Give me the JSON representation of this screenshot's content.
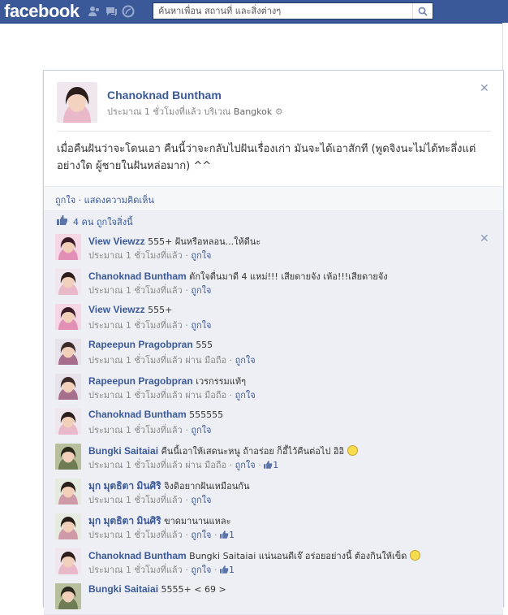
{
  "topbar": {
    "logo": "facebook",
    "search_placeholder": "ค้นหาเพื่อน สถานที่ และสิ่งต่างๆ"
  },
  "post": {
    "author": "Chanoknad Buntham",
    "time": "ประมาณ 1 ชั่วโมงที่แล้ว",
    "location_prefix": "บริเวณ",
    "location": "Bangkok",
    "text": "เมื่อคืนฝันว่าจะโดนเอา คืนนี้ว่าจะกลับไปฝันเรื่องเก่า มันจะได้เอาสักที (พูดจิงนะไม่ได้ทะลึ่งแต่อย่างใด ผู้ชายในฝันหล่อมาก) ^^",
    "actions": "ถูกใจ · แสดงความคิดเห็น",
    "likes": "4 คน ถูกใจสิ่งนี้"
  },
  "comments": [
    {
      "name": "View Viewzz",
      "text": "555+ ฝันหรือหลอน...ให้ดีนะ",
      "meta": "ประมาณ 1 ชั่วโมงที่แล้ว · ",
      "like": "ถูกใจ",
      "count": ""
    },
    {
      "name": "Chanoknad Buntham",
      "text": "ตักใจตื่นมาดี 4 แหม่!!! เสียดายจัง เห้อ!!!เสียดายจัง",
      "meta": "ประมาณ 1 ชั่วโมงที่แล้ว · ",
      "like": "ถูกใจ",
      "count": ""
    },
    {
      "name": "View Viewzz",
      "text": "555+",
      "meta": "ประมาณ 1 ชั่วโมงที่แล้ว · ",
      "like": "ถูกใจ",
      "count": ""
    },
    {
      "name": "Rapeepun Pragobpran",
      "text": "555",
      "meta": "ประมาณ 1 ชั่วโมงที่แล้ว ผ่าน มือถือ · ",
      "like": "ถูกใจ",
      "count": ""
    },
    {
      "name": "Rapeepun Pragobpran",
      "text": "เวรกรรมแท้ๆ",
      "meta": "ประมาณ 1 ชั่วโมงที่แล้ว ผ่าน มือถือ · ",
      "like": "ถูกใจ",
      "count": ""
    },
    {
      "name": "Chanoknad Buntham",
      "text": "555555",
      "meta": "ประมาณ 1 ชั่วโมงที่แล้ว · ",
      "like": "ถูกใจ",
      "count": ""
    },
    {
      "name": "Bungki Saitaiai",
      "text": "คืนนี้เอาให้เสดนะหนู ถ้าอร่อย ก็อี้ไว้คืนต่อไป อิอิ",
      "meta": "ประมาณ 1 ชั่วโมงที่แล้ว ผ่าน มือถือ · ",
      "like": "ถูกใจ",
      "count": "1"
    },
    {
      "name": "มุก มุตธิตา มินศิริ",
      "text": "จิงดิอยากฝันเหมือนกัน",
      "meta": "ประมาณ 1 ชั่วโมงที่แล้ว · ",
      "like": "ถูกใจ",
      "count": ""
    },
    {
      "name": "มุก มุตธิตา มินศิริ",
      "text": "ขาดมานานแหละ",
      "meta": "ประมาณ 1 ชั่วโมงที่แล้ว · ",
      "like": "ถูกใจ",
      "count": "1"
    },
    {
      "name": "Chanoknad Buntham",
      "text": "Bungki Saitaiai แน่นอนดีเจ๊ อร่อยอย่างนี้ ต้องกินให้เข็ด",
      "meta": "ประมาณ 1 ชั่วโมงที่แล้ว · ",
      "like": "ถูกใจ",
      "count": "1"
    },
    {
      "name": "Bungki Saitaiai",
      "text": "5555+ < 69 >",
      "meta": "",
      "like": "",
      "count": ""
    }
  ],
  "colors": {
    "brand": "#3b5998",
    "link": "#3b5998",
    "comment_bg": "#edeff4"
  }
}
